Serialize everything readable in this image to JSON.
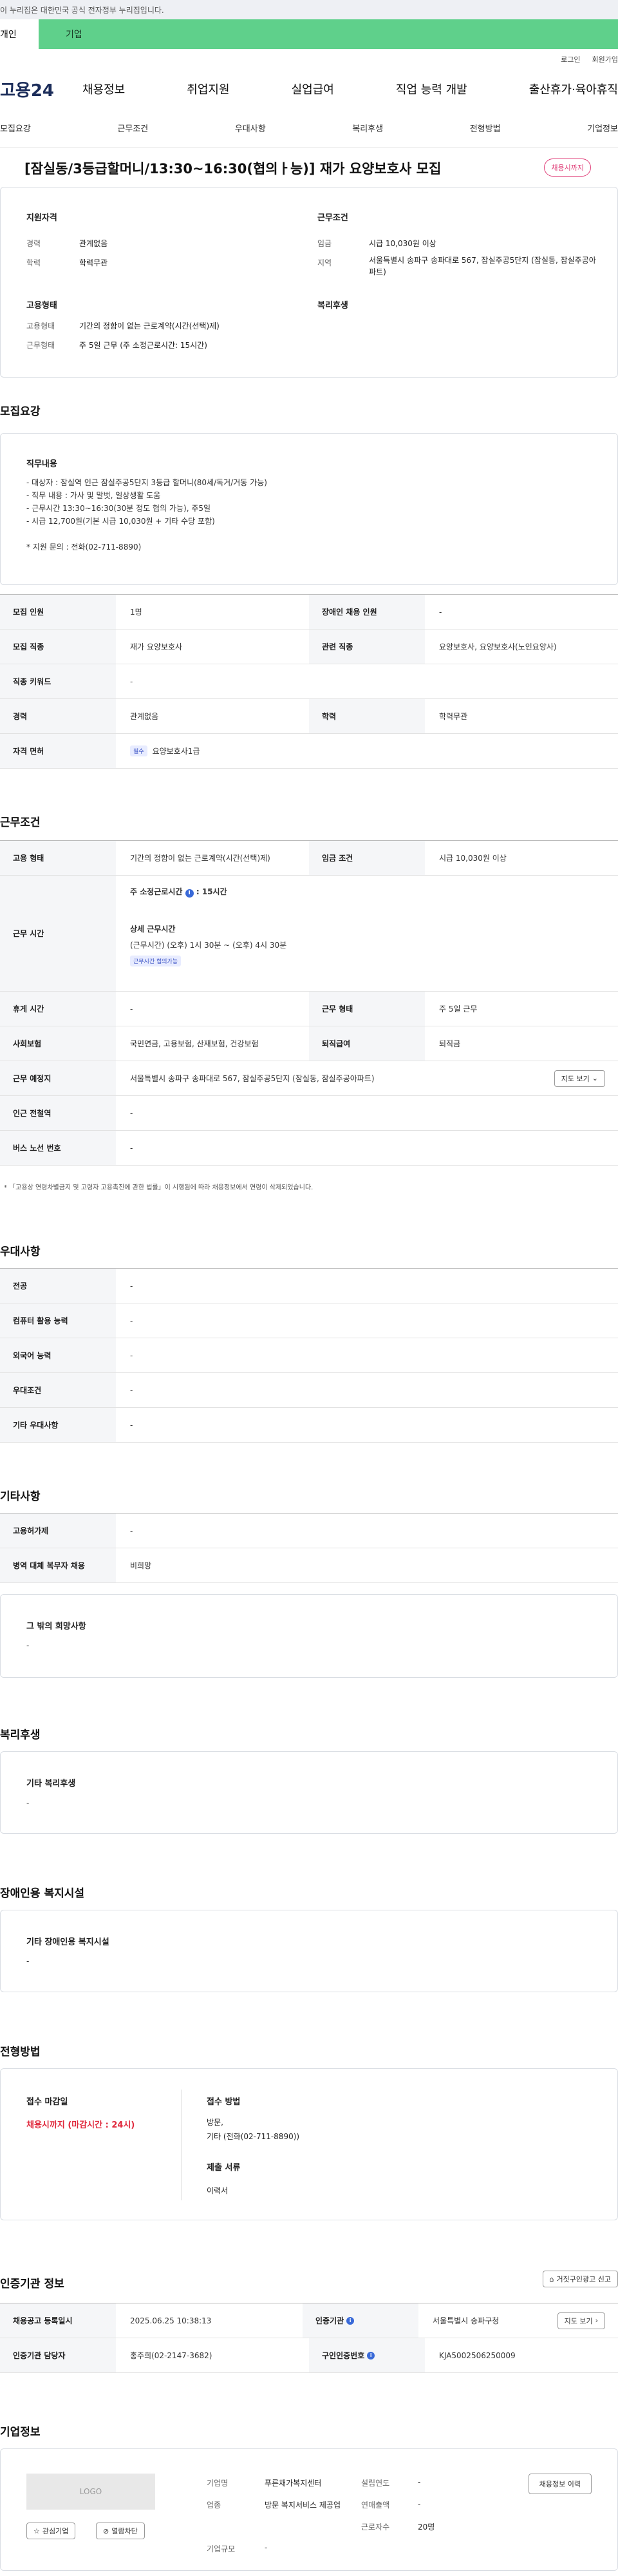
{
  "gov_banner": "이 누리집은 대한민국 공식 전자정부 누리집입니다.",
  "tabs": {
    "person": "개인",
    "company": "기업"
  },
  "util": {
    "login": "로그인",
    "join": "회원가입"
  },
  "gnb": {
    "logo": "고용24",
    "items": [
      "채용정보",
      "취업지원",
      "실업급여",
      "직업 능력 개발",
      "출산휴가·육아휴직"
    ]
  },
  "subnav": [
    "모집요강",
    "근무조건",
    "우대사항",
    "복리후생",
    "전형방법",
    "기업정보"
  ],
  "job": {
    "title": "[잠실동/3등급할머니/13:30~16:30(협의ㅏ능)] 재가 요양보호사 모집",
    "status_badge": "채용시까지",
    "qual_title": "지원자격",
    "career_label": "경력",
    "career": "관계없음",
    "edu_label": "학력",
    "edu": "학력무관",
    "cond_title": "근무조건",
    "wage_label": "임금",
    "wage": "시급 10,030원 이상",
    "region_label": "지역",
    "region": "서울특별시 송파구 송파대로 567, 잠실주공5단지 (잠실동, 잠실주공아파트)",
    "emp_title": "고용형태",
    "emp_type_label": "고용형태",
    "emp_type": "기간의 정함이 없는 근로계약(시간(선택)제)",
    "work_form_label": "근무형태",
    "work_form": "주 5일 근무 (주 소정근로시간: 15시간)",
    "welfare_title": "복리후생"
  },
  "recruit": {
    "section_title": "모집요강",
    "duty_title": "직무내용",
    "duty_lines": [
      "- 대상자 : 잠실역 인근 잠실주공5단지 3등급 할머니(80세/독거/거동 가능)",
      "- 직무 내용 : 가사 및 말벗, 일상생활 도움",
      "- 근무시간 13:30~16:30(30분 정도 협의 가능), 주5일",
      "- 시급 12,700원(기본 시급 10,030원 + 기타 수당 포함)",
      "",
      "* 지원 문의 :  전화(02-711-8890)"
    ],
    "rows": [
      {
        "l1": "모집 인원",
        "v1": "1명",
        "l2": "장애인 채용 인원",
        "v2": "-"
      },
      {
        "l1": "모집 직종",
        "v1": "재가 요양보호사",
        "l2": "관련 직종",
        "v2": "요양보호사, 요양보호사(노인요양사)"
      },
      {
        "l1": "직종 키워드",
        "v1": "-"
      },
      {
        "l1": "경력",
        "v1": "관계없음",
        "l2": "학력",
        "v2": "학력무관"
      },
      {
        "l1": "자격 면허",
        "badge": "필수",
        "v1": "요양보호사1급"
      }
    ]
  },
  "condition": {
    "section_title": "근무조건",
    "emp_label": "고용 형태",
    "emp": "기간의 정함이 없는 근로계약(시간(선택)제)",
    "wage_label": "임금 조건",
    "wage": "시급 10,030원 이상",
    "hours_label": "근무 시간",
    "weekly_hours_label": "주 소정근로시간",
    "weekly_hours": ": 15시간",
    "detail_label": "상세 근무시간",
    "detail_value": "(근무시간) (오후) 1시 30분 ~ (오후) 4시 30분",
    "detail_badge": "근무시간 협의가능",
    "rest_label": "휴게 시간",
    "rest": "-",
    "form_label": "근무 형태",
    "form": "주 5일 근무",
    "insurance_label": "사회보험",
    "insurance": "국민연금, 고용보험, 산재보험, 건강보험",
    "retire_label": "퇴직급여",
    "retire": "퇴직금",
    "place_label": "근무 예정지",
    "place": "서울특별시 송파구 송파대로 567, 잠실주공5단지 (잠실동, 잠실주공아파트)",
    "map_btn": "지도 보기",
    "subway_label": "인근 전철역",
    "subway": "-",
    "bus_label": "버스 노선 번호",
    "bus": "-",
    "note": "* 「고용상 연령차별금지 및 고령자 고용촉진에 관한 법률」이 시행됨에 따라 채용정보에서 연령이 삭제되었습니다."
  },
  "preference": {
    "section_title": "우대사항",
    "rows": [
      {
        "label": "전공",
        "value": "-"
      },
      {
        "label": "컴퓨터 활용 능력",
        "value": "-"
      },
      {
        "label": "외국어 능력",
        "value": "-"
      },
      {
        "label": "우대조건",
        "value": "-"
      },
      {
        "label": "기타 우대사항",
        "value": "-"
      }
    ]
  },
  "etc": {
    "section_title": "기타사항",
    "rows": [
      {
        "label": "고용허가제",
        "value": "-"
      },
      {
        "label": "병역 대체 복무자 채용",
        "value": "비희망"
      }
    ],
    "other_title": "그 밖의 희망사항",
    "other_value": "-"
  },
  "welfare": {
    "section_title": "복리후생",
    "box_title": "기타 복리후생",
    "box_value": "-"
  },
  "disability": {
    "section_title": "장애인용 복지시설",
    "box_title": "기타 장애인용 복지시설",
    "box_value": "-"
  },
  "selection": {
    "section_title": "전형방법",
    "deadline_label": "접수 마감일",
    "deadline_value": "채용시까지 (마감시간 : 24시)",
    "method_label": "접수 방법",
    "method_value1": "방문,",
    "method_value2": "기타 (전화(02-711-8890))",
    "docs_label": "제출 서류",
    "docs_value": "이력서"
  },
  "agency": {
    "section_title": "인증기관 정보",
    "report_btn": "거짓구인광고 신고",
    "reg_label": "채용공고 등록일시",
    "reg": "2025.06.25 10:38:13",
    "org_label": "인증기관",
    "org": "서울특별시 송파구청",
    "map_btn": "지도 보기",
    "manager_label": "인증기관 담당자",
    "manager": "홍주희(02-2147-3682)",
    "certno_label": "구인인증번호",
    "certno": "KJA5002506250009"
  },
  "company": {
    "section_title": "기업정보",
    "logo_text": "LOGO",
    "fav_btn": "관심기업",
    "block_btn": "열람차단",
    "name_label": "기업명",
    "name": "푸른채가복지센터",
    "industry_label": "업종",
    "industry": "방문 복지서비스 제공업",
    "scale_label": "기업규모",
    "scale": "-",
    "founded_label": "설립연도",
    "founded": "-",
    "sales_label": "연매출액",
    "sales": "-",
    "staff_label": "근로자수",
    "staff": "20명",
    "history_btn": "채용정보 이력"
  }
}
